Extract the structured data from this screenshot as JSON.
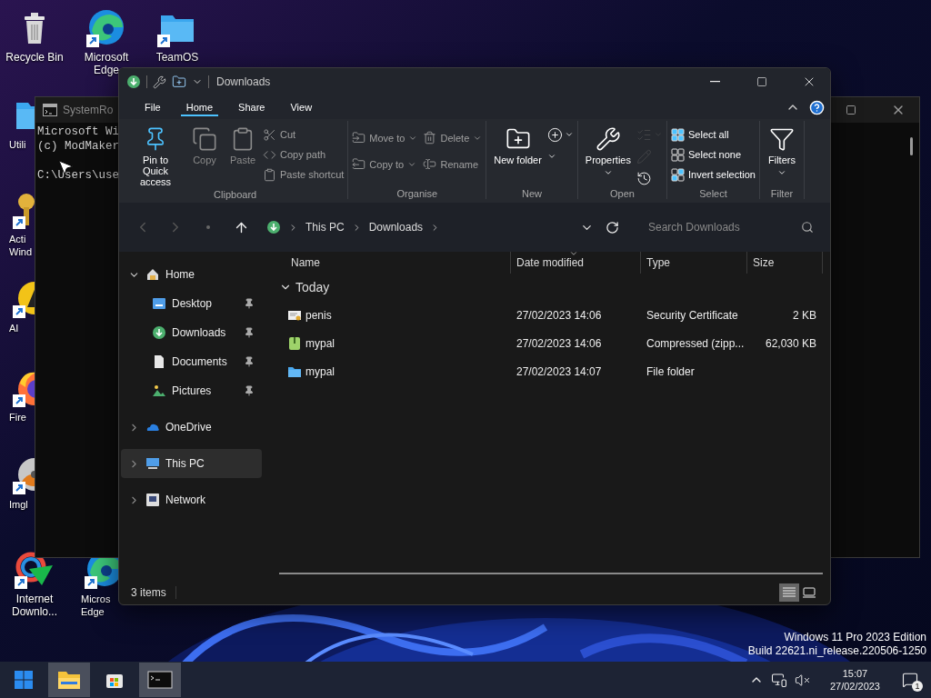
{
  "desktop_icons": [
    {
      "label": "Recycle Bin",
      "kind": "bin",
      "shortcut": false
    },
    {
      "label": "Microsoft\nEdge",
      "kind": "edge",
      "shortcut": true
    },
    {
      "label": "TeamOS",
      "kind": "folder",
      "shortcut": true
    },
    {
      "label": "Utili",
      "kind": "folder",
      "shortcut": false
    },
    {
      "label": "Acti\nWind",
      "kind": "key",
      "shortcut": true
    },
    {
      "label": "AI",
      "kind": "aim",
      "shortcut": true
    },
    {
      "label": "Fire",
      "kind": "firefox",
      "shortcut": true
    },
    {
      "label": "Imgl",
      "kind": "disc",
      "shortcut": true
    },
    {
      "label": "Internet\nDownlo...",
      "kind": "idm",
      "shortcut": true
    },
    {
      "label": "Micros\nEdge",
      "kind": "edge",
      "shortcut": true
    }
  ],
  "cmd_window": {
    "title": "SystemRo",
    "lines": [
      "Microsoft Wi",
      "(c) ModMaker",
      "C:\\Users\\use"
    ]
  },
  "explorer": {
    "title": "Downloads",
    "tabs": [
      {
        "label": "File",
        "selected": false
      },
      {
        "label": "Home",
        "selected": true
      },
      {
        "label": "Share",
        "selected": false
      },
      {
        "label": "View",
        "selected": false
      }
    ],
    "ribbon_groups": [
      {
        "label": "Clipboard",
        "commands": [
          {
            "label": "Pin to Quick access",
            "kind": "large",
            "disabled": false,
            "dropdown": false
          },
          {
            "label": "Copy",
            "kind": "large",
            "disabled": true,
            "dropdown": false
          },
          {
            "label": "Paste",
            "kind": "large",
            "disabled": true,
            "dropdown": false
          },
          {
            "label": "Cut",
            "kind": "small",
            "disabled": true,
            "dropdown": false
          },
          {
            "label": "Copy path",
            "kind": "small",
            "disabled": true,
            "dropdown": false
          },
          {
            "label": "Paste shortcut",
            "kind": "small",
            "disabled": true,
            "dropdown": false
          }
        ]
      },
      {
        "label": "Organise",
        "commands": [
          {
            "label": "Move to",
            "kind": "small",
            "disabled": true,
            "dropdown": true
          },
          {
            "label": "Copy to",
            "kind": "small",
            "disabled": true,
            "dropdown": true
          },
          {
            "label": "Delete",
            "kind": "small",
            "disabled": true,
            "dropdown": true
          },
          {
            "label": "Rename",
            "kind": "small",
            "disabled": true,
            "dropdown": false
          }
        ]
      },
      {
        "label": "New",
        "commands": [
          {
            "label": "New folder",
            "kind": "large",
            "disabled": false,
            "dropdown": false
          },
          {
            "kind": "icon",
            "disabled": false,
            "dropdown": true
          },
          {
            "kind": "icon",
            "disabled": false,
            "dropdown": true
          }
        ]
      },
      {
        "label": "Open",
        "commands": [
          {
            "label": "Properties",
            "kind": "large",
            "disabled": false,
            "dropdown": true
          },
          {
            "kind": "icon",
            "disabled": true,
            "dropdown": true
          },
          {
            "kind": "icon",
            "disabled": true,
            "dropdown": false
          },
          {
            "kind": "icon",
            "disabled": false,
            "dropdown": false
          }
        ]
      },
      {
        "label": "Select",
        "commands": [
          {
            "label": "Select all",
            "kind": "small",
            "disabled": false,
            "dropdown": false
          },
          {
            "label": "Select none",
            "kind": "small",
            "disabled": false,
            "dropdown": false
          },
          {
            "label": "Invert selection",
            "kind": "small",
            "disabled": false,
            "dropdown": false
          }
        ]
      },
      {
        "label": "Filter",
        "commands": [
          {
            "label": "Filters",
            "kind": "large",
            "disabled": false,
            "dropdown": true
          }
        ]
      }
    ],
    "breadcrumb": [
      "This PC",
      "Downloads"
    ],
    "search": {
      "placeholder": "Search Downloads"
    },
    "nav_tree": [
      {
        "label": "Home",
        "kind": "home",
        "expanded": true,
        "selected": false,
        "children": [
          {
            "label": "Desktop",
            "kind": "desktop",
            "pinned": true
          },
          {
            "label": "Downloads",
            "kind": "downloads",
            "pinned": true
          },
          {
            "label": "Documents",
            "kind": "documents",
            "pinned": true
          },
          {
            "label": "Pictures",
            "kind": "pictures",
            "pinned": true
          }
        ]
      },
      {
        "label": "OneDrive",
        "kind": "cloud",
        "expanded": false,
        "selected": false
      },
      {
        "label": "This PC",
        "kind": "pc",
        "expanded": false,
        "selected": true
      },
      {
        "label": "Network",
        "kind": "network",
        "expanded": false,
        "selected": false
      }
    ],
    "columns": [
      {
        "label": "Name",
        "sorted": false
      },
      {
        "label": "Date modified",
        "sorted": true
      },
      {
        "label": "Type",
        "sorted": false
      },
      {
        "label": "Size",
        "sorted": false
      }
    ],
    "groups": [
      {
        "label": "Today",
        "expanded": true,
        "rows": [
          {
            "name": "penis",
            "kind": "certificate",
            "date_modified": "27/02/2023 14:06",
            "type": "Security Certificate",
            "size": "2 KB"
          },
          {
            "name": "mypal",
            "kind": "archive",
            "date_modified": "27/02/2023 14:06",
            "type": "Compressed (zipp...",
            "size": "62,030 KB"
          },
          {
            "name": "mypal",
            "kind": "folder",
            "date_modified": "27/02/2023 14:07",
            "type": "File folder"
          }
        ]
      }
    ],
    "status": "3 items",
    "view_buttons": [
      {
        "kind": "details",
        "selected": true
      },
      {
        "kind": "tiles",
        "selected": false
      }
    ]
  },
  "watermark_lines": [
    "Windows 11 Pro 2023 Edition",
    "Build 22621.ni_release.220506-1250"
  ],
  "taskbar": {
    "apps": [
      {
        "kind": "explorer",
        "active": true
      },
      {
        "kind": "store",
        "active": false
      },
      {
        "kind": "terminal",
        "active": true
      }
    ],
    "time": "15:07",
    "date": "27/02/2023",
    "notification_count": "1"
  }
}
